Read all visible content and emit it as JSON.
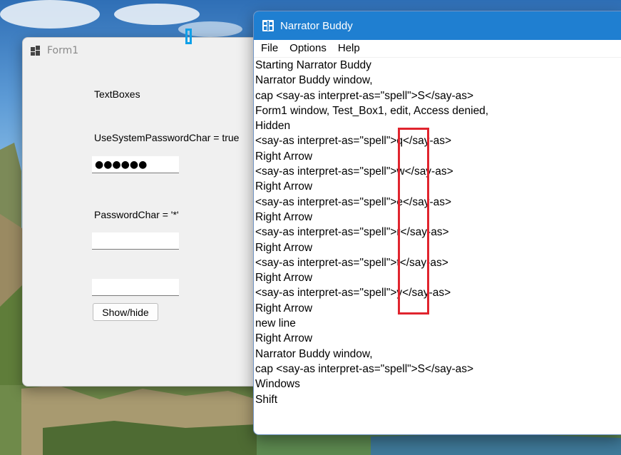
{
  "form1": {
    "title": "Form1",
    "textboxes_label": "TextBoxes",
    "system_password_label": "UseSystemPasswordChar = true",
    "system_password_value": "●●●●●●",
    "password_char_label": "PasswordChar = '*'",
    "password_char_value": "",
    "plain_value": "",
    "show_hide_button": "Show/hide"
  },
  "narrator_buddy": {
    "title": "Narrator Buddy",
    "menu": [
      "File",
      "Options",
      "Help"
    ],
    "log": [
      "Starting Narrator Buddy",
      "Narrator Buddy window,",
      "cap <say-as interpret-as=\"spell\">S</say-as>",
      "Form1 window, Test_Box1, edit, Access denied,",
      "Hidden",
      "<say-as interpret-as=\"spell\">q</say-as>",
      "Right Arrow",
      "<say-as interpret-as=\"spell\">w</say-as>",
      "Right Arrow",
      "<say-as interpret-as=\"spell\">e</say-as>",
      "Right Arrow",
      "<say-as interpret-as=\"spell\">r</say-as>",
      "Right Arrow",
      "<say-as interpret-as=\"spell\">t</say-as>",
      "Right Arrow",
      "<say-as interpret-as=\"spell\">y</say-as>",
      "Right Arrow",
      "new line",
      "Right Arrow",
      "Narrator Buddy window,",
      "cap <say-as interpret-as=\"spell\">S</say-as>",
      "Windows",
      "Shift"
    ]
  },
  "colors": {
    "narrator_titlebar": "#1f7fd1",
    "highlight": "#e0242e",
    "focus_marker": "#0ea0e8"
  }
}
